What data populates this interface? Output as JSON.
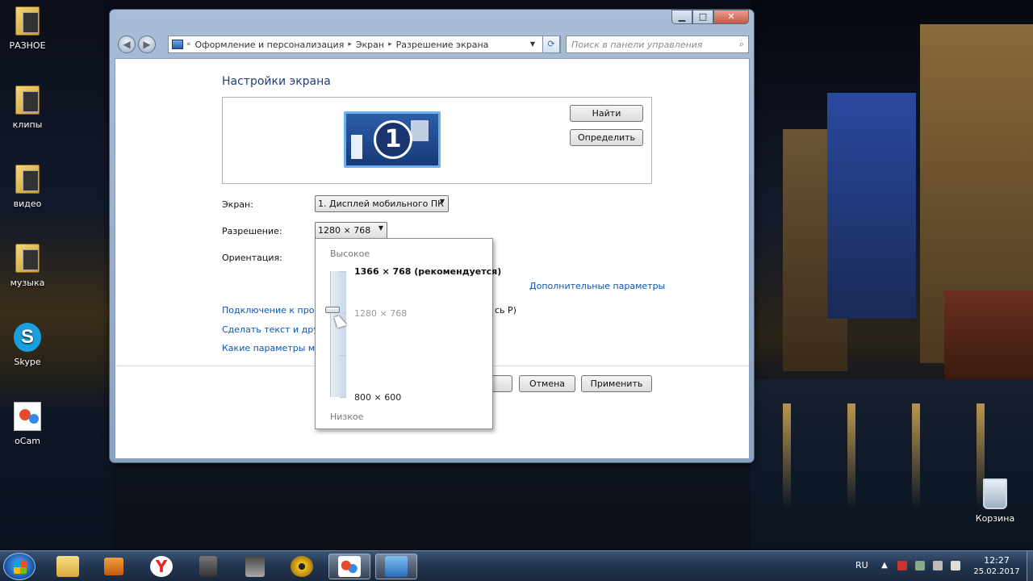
{
  "desktop": {
    "icons": [
      {
        "label": "РАЗНОЕ",
        "icon": "folder-icon"
      },
      {
        "label": "клипы",
        "icon": "folder-icon"
      },
      {
        "label": "видео",
        "icon": "folder-icon"
      },
      {
        "label": "музыка",
        "icon": "folder-icon"
      },
      {
        "label": "Skype",
        "icon": "skype-icon"
      },
      {
        "label": "oCam",
        "icon": "ocam-icon"
      }
    ],
    "recycle_bin": "Корзина"
  },
  "window": {
    "controls": {
      "minimize": "▁",
      "maximize": "□",
      "close": "✕"
    },
    "nav": {
      "back": "◀",
      "forward": "▶"
    },
    "address": {
      "prefix": "«",
      "crumbs": [
        "Оформление и персонализация",
        "Экран",
        "Разрешение экрана"
      ],
      "sep": "▸",
      "dropdown": "▼",
      "refresh": "⟳"
    },
    "search": {
      "placeholder": "Поиск в панели управления",
      "icon": "⌕"
    }
  },
  "settings": {
    "title": "Настройки экрана",
    "monitor_number": "1",
    "buttons": {
      "find": "Найти",
      "identify": "Определить"
    },
    "display": {
      "label": "Экран:",
      "value": "1. Дисплей мобильного ПК"
    },
    "resolution": {
      "label": "Разрешение:",
      "value": "1280 × 768"
    },
    "orientation": {
      "label": "Ориентация:"
    },
    "advanced_link": "Дополнительные параметры",
    "links": [
      "Подключение к проек",
      "Сделать текст и другие",
      "Какие параметры мон"
    ],
    "partial_text": "сь Р)",
    "footer": {
      "cancel": "Отмена",
      "apply": "Применить"
    }
  },
  "resolution_popup": {
    "high_label": "Высокое",
    "low_label": "Низкое",
    "option_max": "1366 × 768 (рекомендуется)",
    "option_current": "1280 × 768",
    "option_min": "800 × 600",
    "slider_level": 0.31
  },
  "taskbar": {
    "apps": [
      "explorer-icon",
      "media-player-icon",
      "yandex-browser-icon",
      "world-of-tanks-icon",
      "game-icon",
      "radiation-icon",
      "ocam-icon",
      "control-panel-icon"
    ],
    "tray": {
      "lang": "RU",
      "time": "12:27",
      "date": "25.02.2017",
      "expand": "▲"
    }
  }
}
